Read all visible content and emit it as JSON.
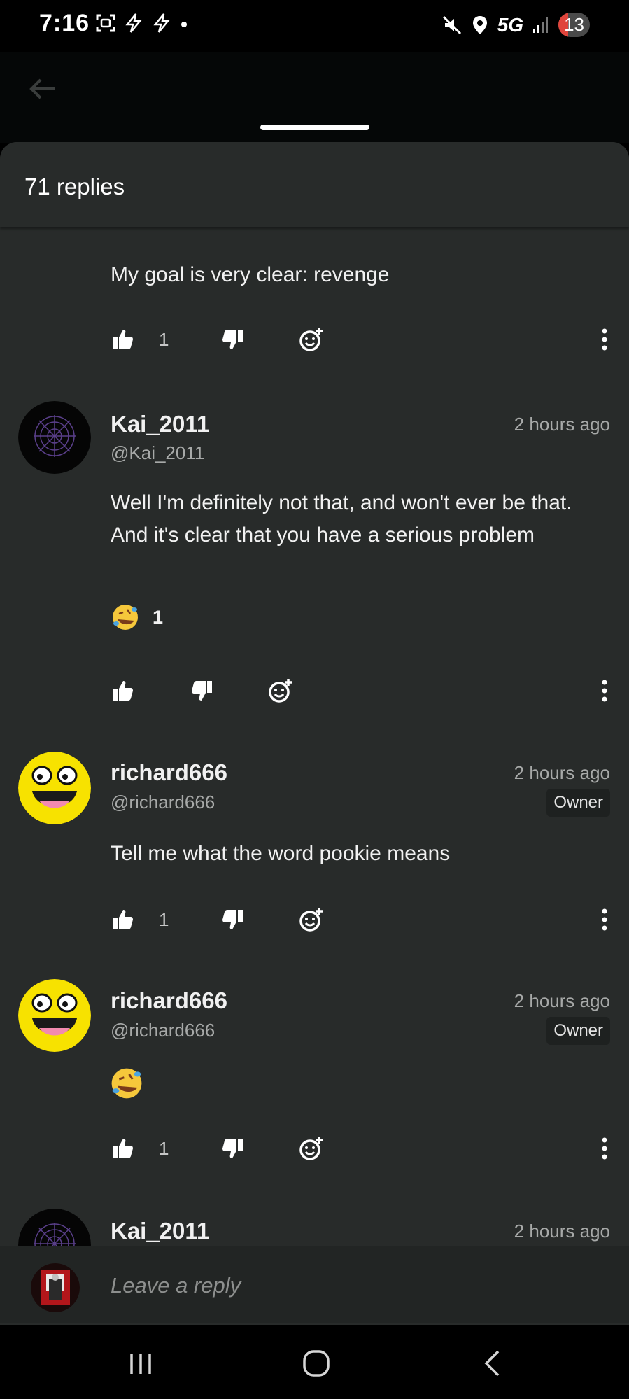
{
  "status": {
    "time": "7:16",
    "network": "5G",
    "battery": "13"
  },
  "sheet": {
    "title": "71 replies"
  },
  "comments": [
    {
      "text": "My goal is very clear: revenge",
      "likes": "1"
    },
    {
      "name": "Kai_2011",
      "handle": "@Kai_2011",
      "time": "2 hours ago",
      "text": "Well I'm definitely not that, and won't ever be that. And it's clear that you have a serious problem",
      "reaction_emoji": "rolling-on-floor-laughing",
      "reaction_count": "1"
    },
    {
      "name": "richard666",
      "handle": "@richard666",
      "time": "2 hours ago",
      "badge": "Owner",
      "text": "Tell me what the word pookie means",
      "likes": "1"
    },
    {
      "name": "richard666",
      "handle": "@richard666",
      "time": "2 hours ago",
      "badge": "Owner",
      "emoji": "rolling-on-floor-laughing",
      "likes": "1"
    },
    {
      "name": "Kai_2011",
      "time": "2 hours ago"
    }
  ],
  "reply": {
    "placeholder": "Leave a reply"
  },
  "colors": {
    "background": "#282b2a",
    "text": "#f1f1f1",
    "muted": "#a7a9a8",
    "accent_face": "#f7e200"
  }
}
